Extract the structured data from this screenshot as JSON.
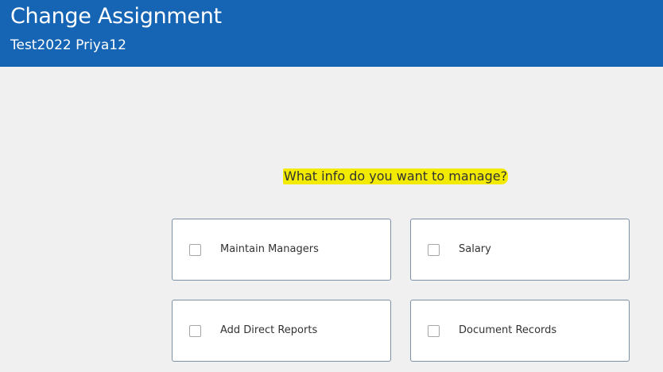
{
  "header": {
    "title": "Change Assignment",
    "subtitle": "Test2022 Priya12"
  },
  "question": "What info do you want to manage?",
  "options": [
    {
      "label": "Maintain Managers",
      "checked": false
    },
    {
      "label": "Salary",
      "checked": false
    },
    {
      "label": "Add Direct Reports",
      "checked": false
    },
    {
      "label": "Document Records",
      "checked": false
    }
  ],
  "colors": {
    "header_bg": "#1565b4",
    "highlight": "#f2ea00",
    "page_bg": "#f0f0f0"
  }
}
